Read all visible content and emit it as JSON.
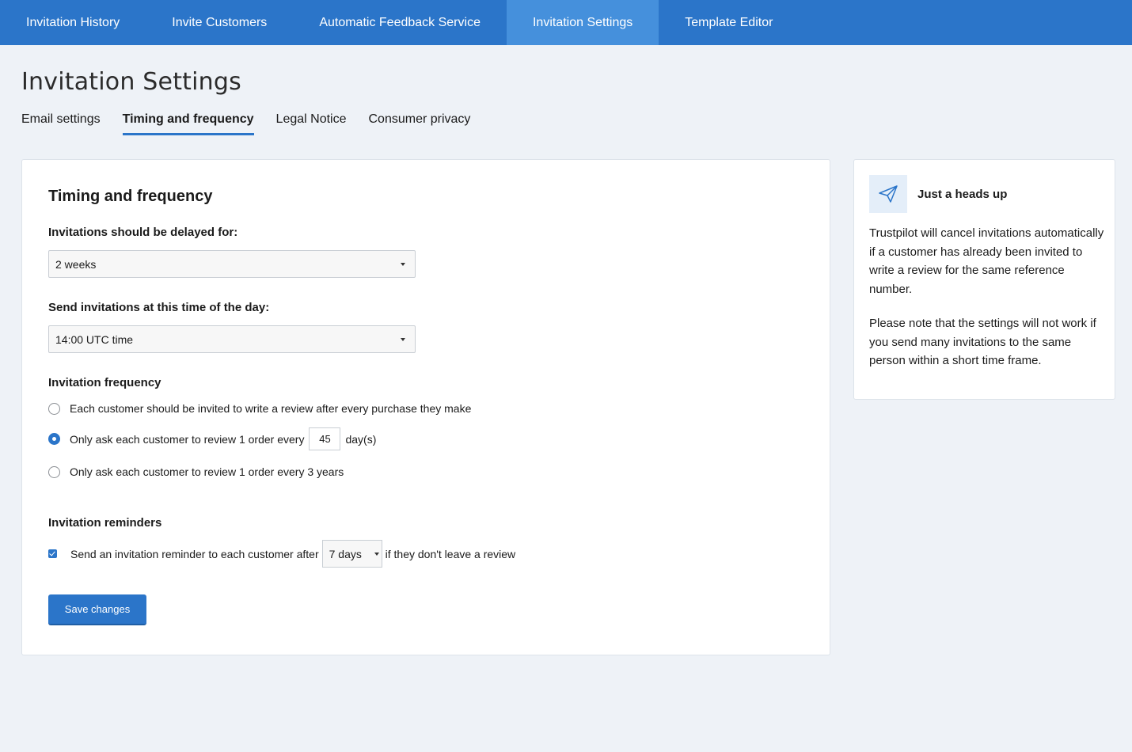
{
  "nav": {
    "items": [
      {
        "label": "Invitation History"
      },
      {
        "label": "Invite Customers"
      },
      {
        "label": "Automatic Feedback Service"
      },
      {
        "label": "Invitation Settings"
      },
      {
        "label": "Template Editor"
      }
    ],
    "active_index": 3
  },
  "page": {
    "title": "Invitation Settings",
    "tabs": [
      {
        "label": "Email settings"
      },
      {
        "label": "Timing and frequency"
      },
      {
        "label": "Legal Notice"
      },
      {
        "label": "Consumer privacy"
      }
    ],
    "active_tab_index": 1
  },
  "form": {
    "title": "Timing and frequency",
    "delay_label": "Invitations should be delayed for:",
    "delay_value": "2 weeks",
    "time_label": "Send invitations at this time of the day:",
    "time_value": "14:00 UTC time",
    "frequency_label": "Invitation frequency",
    "frequency_options": [
      {
        "label": "Each customer should be invited to write a review after every purchase they make",
        "checked": false
      },
      {
        "label_before": "Only ask each customer to review 1 order every",
        "value": "45",
        "label_after": "day(s)",
        "checked": true
      },
      {
        "label": "Only ask each customer to review 1 order every 3 years",
        "checked": false
      }
    ],
    "reminders_label": "Invitation reminders",
    "reminder": {
      "checked": true,
      "label_before": "Send an invitation reminder to each customer after",
      "value": "7 days",
      "label_after": "if they don't leave a review"
    },
    "save_label": "Save changes"
  },
  "sidebar": {
    "icon": "paper-plane-icon",
    "title": "Just a heads up",
    "paragraph1": "Trustpilot will cancel invitations automatically if a customer has already been invited to write a review for the same reference number.",
    "paragraph2": "Please note that the settings will not work if you send many invitations to the same person within a short time frame."
  },
  "colors": {
    "accent": "#2b75c9",
    "nav_active": "#4590dc",
    "background": "#eef2f7"
  }
}
